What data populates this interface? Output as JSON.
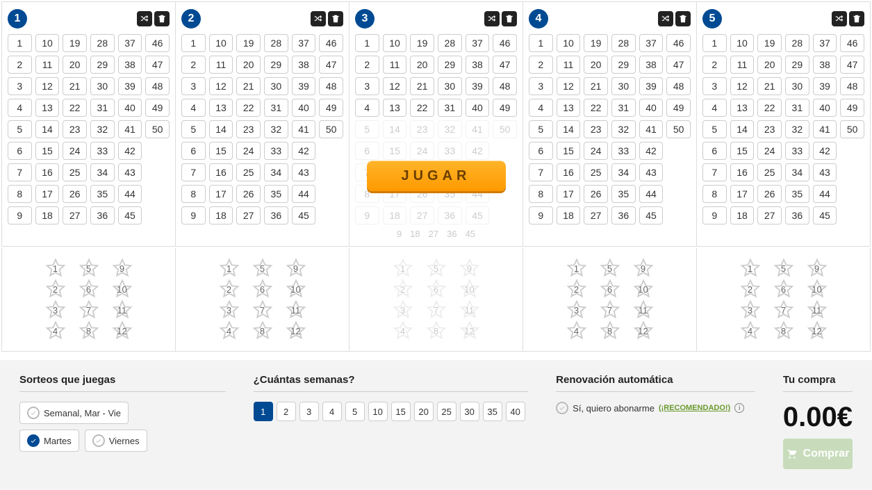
{
  "cards": [
    1,
    2,
    3,
    4,
    5
  ],
  "numbers_max": 50,
  "stars": [
    1,
    5,
    9,
    2,
    6,
    10,
    3,
    7,
    11,
    4,
    8,
    12
  ],
  "card3_visible_last_row": [
    9,
    18,
    27,
    36,
    45
  ],
  "play_label": "JUGAR",
  "bottom": {
    "sorteos": {
      "title": "Sorteos que juegas",
      "opt1": "Semanal, Mar - Vie",
      "opt2": "Martes",
      "opt3": "Viernes"
    },
    "semanas": {
      "title": "¿Cuántas semanas?",
      "options": [
        "1",
        "2",
        "3",
        "4",
        "5",
        "10",
        "15",
        "20",
        "25",
        "30",
        "35",
        "40"
      ],
      "selected": "1"
    },
    "renov": {
      "title": "Renovación automática",
      "label": "Sí, quiero abonarme",
      "reco": "(¡RECOMENDADO!)"
    },
    "compra": {
      "title": "Tu compra",
      "price": "0.00€",
      "buy": "Comprar"
    }
  }
}
